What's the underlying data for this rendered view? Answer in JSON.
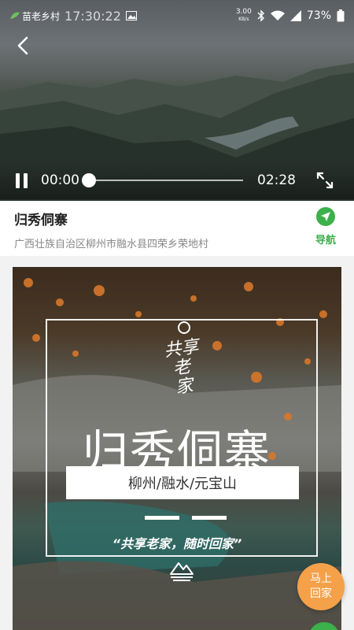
{
  "status_bar": {
    "app_name": "苗老乡村",
    "time": "17:30:22",
    "speed": "3.00",
    "speed_unit": "KB/s",
    "battery": "73%"
  },
  "video": {
    "current_time": "00:00",
    "total_time": "02:28",
    "progress": 0
  },
  "place": {
    "name": "归秀侗寨",
    "address": "广西壮族自治区柳州市融水县四荣乡荣地村",
    "nav_label": "导航"
  },
  "poster": {
    "calligraphy": [
      "共享",
      "老家"
    ],
    "title": "归秀侗寨",
    "subtitle": "柳州/融水/元宝山",
    "slogan": "“共享老家，随时回家”"
  },
  "floating": {
    "go_home_lines": [
      "马上",
      "回家"
    ]
  },
  "colors": {
    "accent_green": "#3cb04a",
    "go_home_orange": "#f4a14a"
  },
  "icons": [
    "back-arrow-icon",
    "pause-icon",
    "fullscreen-icon",
    "navigation-arrow-icon",
    "mountain-logo-icon",
    "wifi-icon",
    "signal-icon",
    "battery-icon",
    "bluetooth-icon"
  ]
}
